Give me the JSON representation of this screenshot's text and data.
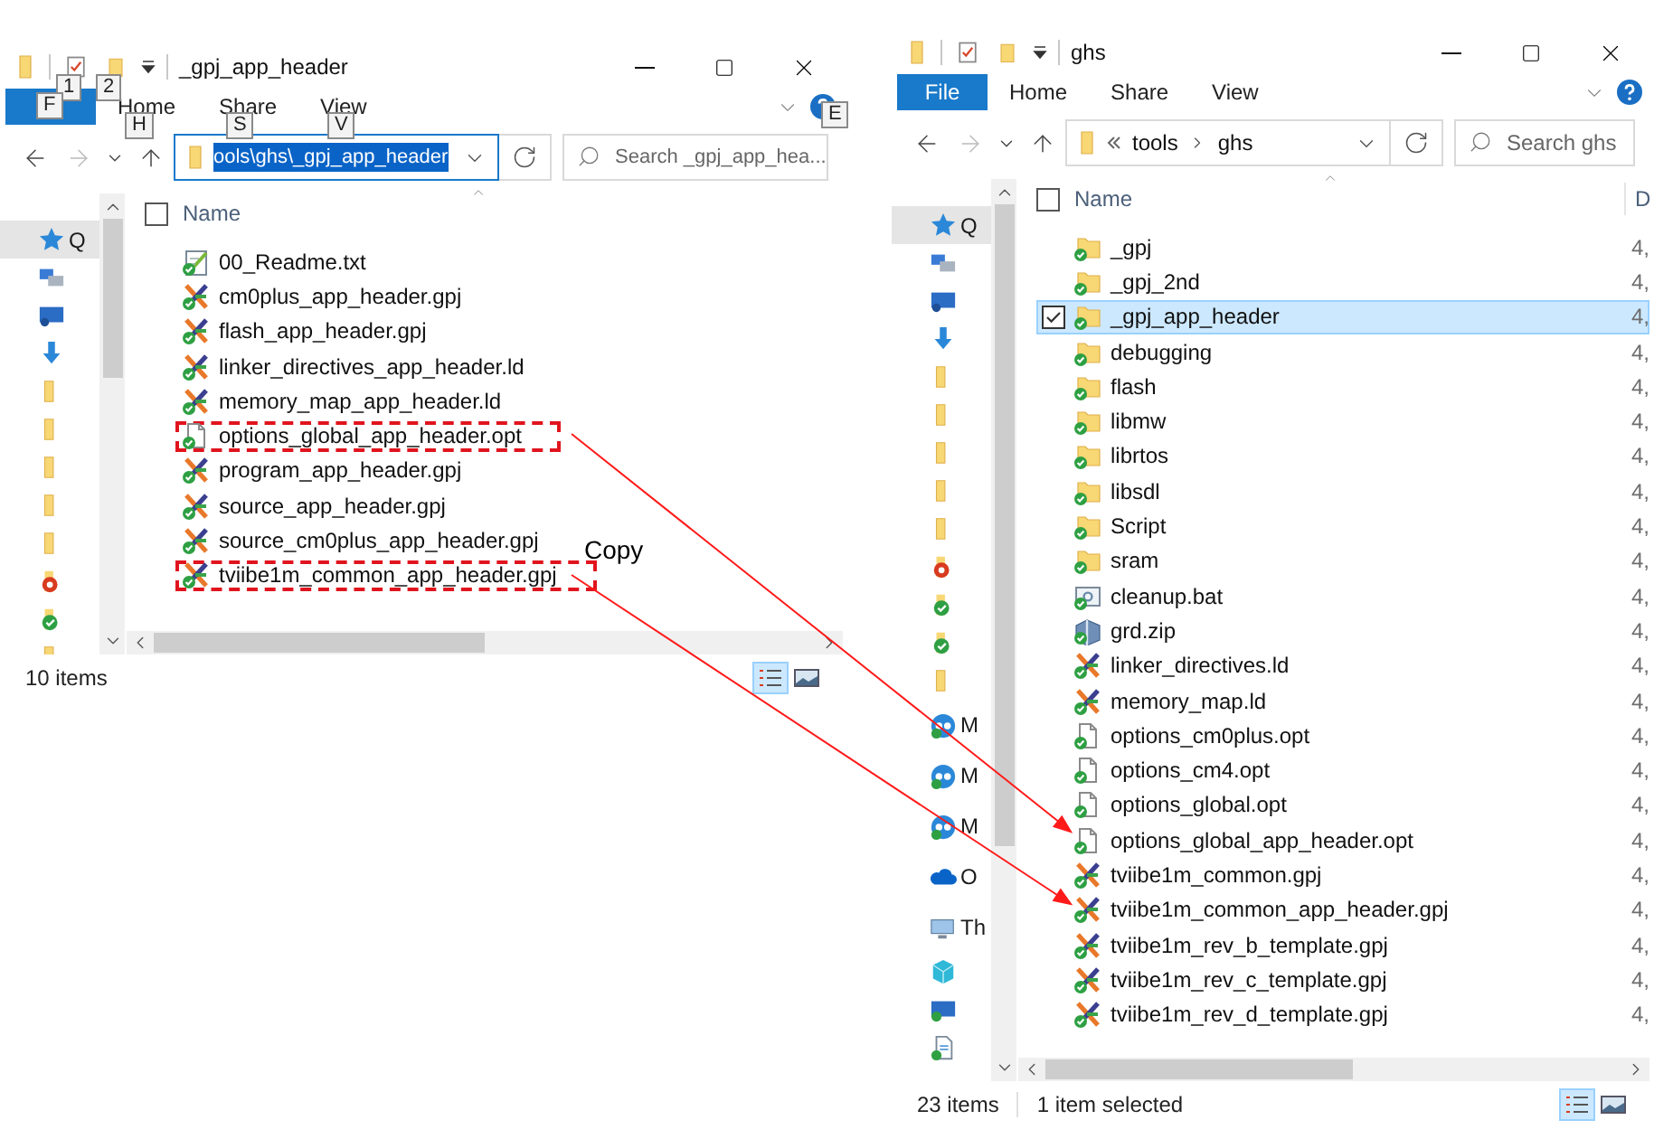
{
  "windows": [
    {
      "title": "_gpj_app_header",
      "qat": [
        {
          "kind": "properties",
          "keytip": "1"
        },
        {
          "kind": "new-folder",
          "keytip": "2"
        }
      ],
      "tabs": [
        {
          "kind": "file",
          "keytip": "F"
        },
        {
          "kind": "tab",
          "label": "Home",
          "keytip": "H"
        },
        {
          "kind": "tab",
          "label": "Share",
          "keytip": "S"
        },
        {
          "kind": "tab",
          "label": "View",
          "keytip": "V"
        }
      ],
      "help": {
        "keytip": "E"
      },
      "address": {
        "kind": "edit",
        "focused": true,
        "text": "ools\\ghs\\_gpj_app_header",
        "text_selected": true
      },
      "search": {
        "placeholder": "Search _gpj_app_hea..."
      },
      "nav": [
        {
          "kind": "quick",
          "label": "Q",
          "selected": true
        },
        {
          "kind": "network",
          "selected": false
        },
        {
          "kind": "monitor",
          "selected": false
        },
        {
          "kind": "download",
          "selected": false
        },
        {
          "kind": "folder",
          "selected": false
        },
        {
          "kind": "folder",
          "selected": false
        },
        {
          "kind": "folder",
          "selected": false
        },
        {
          "kind": "folder",
          "selected": false
        },
        {
          "kind": "folder",
          "selected": false
        },
        {
          "kind": "error",
          "selected": false
        },
        {
          "kind": "synced-folder",
          "selected": false
        },
        {
          "kind": "folder",
          "selected": false
        }
      ],
      "select_all": {
        "checked": false
      },
      "columns": [
        {
          "label": "Name"
        }
      ],
      "files": [
        {
          "name": "00_Readme.txt",
          "kind": "txt",
          "selected": false,
          "highlighted": false
        },
        {
          "name": "cm0plus_app_header.gpj",
          "kind": "gpj",
          "selected": false,
          "highlighted": false
        },
        {
          "name": "flash_app_header.gpj",
          "kind": "gpj",
          "selected": false,
          "highlighted": false
        },
        {
          "name": "linker_directives_app_header.ld",
          "kind": "ld",
          "selected": false,
          "highlighted": false
        },
        {
          "name": "memory_map_app_header.ld",
          "kind": "ld",
          "selected": false,
          "highlighted": false
        },
        {
          "name": "options_global_app_header.opt",
          "kind": "opt",
          "selected": false,
          "highlighted": true
        },
        {
          "name": "program_app_header.gpj",
          "kind": "gpj",
          "selected": false,
          "highlighted": false
        },
        {
          "name": "source_app_header.gpj",
          "kind": "gpj",
          "selected": false,
          "highlighted": false
        },
        {
          "name": "source_cm0plus_app_header.gpj",
          "kind": "gpj",
          "selected": false,
          "highlighted": false
        },
        {
          "name": "tviibe1m_common_app_header.gpj",
          "kind": "gpj",
          "selected": false,
          "highlighted": true
        }
      ],
      "status": {
        "count": "10 items"
      },
      "views": [
        {
          "kind": "details",
          "selected": true
        },
        {
          "kind": "tiles",
          "selected": false
        }
      ]
    },
    {
      "title": "ghs",
      "qat": [
        {
          "kind": "properties"
        },
        {
          "kind": "new-folder"
        }
      ],
      "tabs": [
        {
          "kind": "file",
          "label": "File"
        },
        {
          "kind": "tab",
          "label": "Home"
        },
        {
          "kind": "tab",
          "label": "Share"
        },
        {
          "kind": "tab",
          "label": "View"
        }
      ],
      "address": {
        "kind": "breadcrumb",
        "focused": false,
        "crumbs": [
          "tools",
          "ghs"
        ]
      },
      "search": {
        "placeholder": "Search ghs"
      },
      "nav": [
        {
          "kind": "quick",
          "label": "Q",
          "selected": true
        },
        {
          "kind": "network",
          "selected": false
        },
        {
          "kind": "monitor",
          "selected": false
        },
        {
          "kind": "download",
          "selected": false
        },
        {
          "kind": "folder",
          "selected": false
        },
        {
          "kind": "folder",
          "selected": false
        },
        {
          "kind": "folder",
          "selected": false
        },
        {
          "kind": "folder",
          "selected": false
        },
        {
          "kind": "folder",
          "selected": false
        },
        {
          "kind": "error",
          "selected": false
        },
        {
          "kind": "synced-folder",
          "selected": false
        },
        {
          "kind": "synced-folder",
          "selected": false
        },
        {
          "kind": "folder",
          "selected": false
        },
        {
          "kind": "cloud-app",
          "label": "M",
          "selected": false
        },
        {
          "kind": "cloud-app",
          "label": "M",
          "selected": false
        },
        {
          "kind": "cloud-app",
          "label": "M",
          "selected": false
        },
        {
          "kind": "onedrive",
          "label": "O",
          "selected": false
        },
        {
          "kind": "pc",
          "label": "Th",
          "selected": false
        },
        {
          "kind": "cube",
          "selected": false
        },
        {
          "kind": "desktop",
          "selected": false
        },
        {
          "kind": "document",
          "selected": false
        }
      ],
      "select_all": {
        "checked": false
      },
      "columns": [
        {
          "label": "Name"
        },
        {
          "label": "D"
        }
      ],
      "files": [
        {
          "name": "_gpj",
          "kind": "folder",
          "column_2": "4,",
          "selected": false,
          "highlighted": false
        },
        {
          "name": "_gpj_2nd",
          "kind": "folder",
          "column_2": "4,",
          "selected": false,
          "highlighted": false
        },
        {
          "name": "_gpj_app_header",
          "kind": "folder",
          "column_2": "4,",
          "selected": true,
          "highlighted": false
        },
        {
          "name": "debugging",
          "kind": "folder",
          "column_2": "4,",
          "selected": false,
          "highlighted": false
        },
        {
          "name": "flash",
          "kind": "folder",
          "column_2": "4,",
          "selected": false,
          "highlighted": false
        },
        {
          "name": "libmw",
          "kind": "folder",
          "column_2": "4,",
          "selected": false,
          "highlighted": false
        },
        {
          "name": "librtos",
          "kind": "folder",
          "column_2": "4,",
          "selected": false,
          "highlighted": false
        },
        {
          "name": "libsdl",
          "kind": "folder",
          "column_2": "4,",
          "selected": false,
          "highlighted": false
        },
        {
          "name": "Script",
          "kind": "folder",
          "column_2": "4,",
          "selected": false,
          "highlighted": false
        },
        {
          "name": "sram",
          "kind": "folder",
          "column_2": "4,",
          "selected": false,
          "highlighted": false
        },
        {
          "name": "cleanup.bat",
          "kind": "bat",
          "column_2": "4,",
          "selected": false,
          "highlighted": false
        },
        {
          "name": "grd.zip",
          "kind": "zip",
          "column_2": "4,",
          "selected": false,
          "highlighted": false
        },
        {
          "name": "linker_directives.ld",
          "kind": "ld",
          "column_2": "4,",
          "selected": false,
          "highlighted": false
        },
        {
          "name": "memory_map.ld",
          "kind": "ld",
          "column_2": "4,",
          "selected": false,
          "highlighted": false
        },
        {
          "name": "options_cm0plus.opt",
          "kind": "opt",
          "column_2": "4,",
          "selected": false,
          "highlighted": false
        },
        {
          "name": "options_cm4.opt",
          "kind": "opt",
          "column_2": "4,",
          "selected": false,
          "highlighted": false
        },
        {
          "name": "options_global.opt",
          "kind": "opt",
          "column_2": "4,",
          "selected": false,
          "highlighted": false
        },
        {
          "name": "options_global_app_header.opt",
          "kind": "opt",
          "column_2": "4,",
          "selected": false,
          "highlighted": false
        },
        {
          "name": "tviibe1m_common.gpj",
          "kind": "gpj",
          "column_2": "4,",
          "selected": false,
          "highlighted": false
        },
        {
          "name": "tviibe1m_common_app_header.gpj",
          "kind": "gpj",
          "column_2": "4,",
          "selected": false,
          "highlighted": false
        },
        {
          "name": "tviibe1m_rev_b_template.gpj",
          "kind": "gpj",
          "column_2": "4,",
          "selected": false,
          "highlighted": false
        },
        {
          "name": "tviibe1m_rev_c_template.gpj",
          "kind": "gpj",
          "column_2": "4,",
          "selected": false,
          "highlighted": false
        },
        {
          "name": "tviibe1m_rev_d_template.gpj",
          "kind": "gpj",
          "column_2": "4,",
          "selected": false,
          "highlighted": false
        }
      ],
      "status": {
        "count": "23 items",
        "selection": "1 item selected"
      },
      "views": [
        {
          "kind": "details",
          "selected": true
        },
        {
          "kind": "tiles",
          "selected": false
        }
      ]
    }
  ],
  "annotation": {
    "label": "Copy"
  }
}
